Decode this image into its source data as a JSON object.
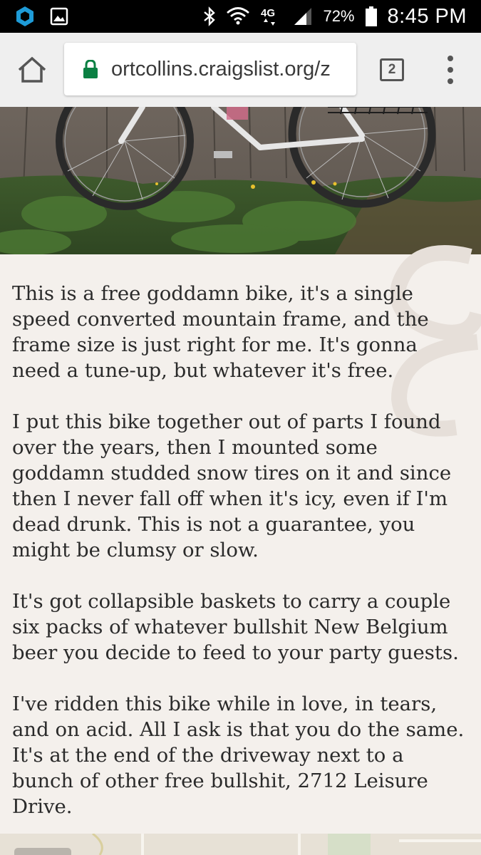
{
  "status_bar": {
    "left_icons": [
      "dex-icon",
      "image-icon"
    ],
    "right_icons": [
      "bluetooth-icon",
      "wifi-icon",
      "lte-icon",
      "signal-icon",
      "battery-icon"
    ],
    "network_label": "4G",
    "battery_percent": "72%",
    "time": "8:45 PM"
  },
  "browser": {
    "url": "ortcollins.craigslist.org/z",
    "tab_count": "2",
    "icons": {
      "home": "home-icon",
      "lock": "lock-icon",
      "menu": "more-vert-icon"
    },
    "colors": {
      "lock": "#0b8043"
    }
  },
  "post": {
    "image": "photo of a white single-speed bike leaning against a wooden fence",
    "paragraphs": [
      "This is a free goddamn bike, it's a single\nspeed converted mountain frame, and the\nframe size is just right for me. It's gonna\nneed a tune-up, but whatever it's free.",
      "I put this bike together out of parts I found\nover the years, then I mounted some\ngoddamn studded snow tires on it and since\nthen I never fall off when it's icy, even if I'm\ndead drunk. This is not a guarantee, you\nmight be clumsy or slow.",
      "It's got collapsible baskets to carry a couple\nsix packs of whatever bullshit New Belgium\nbeer you decide to feed to your party guests.",
      "I've ridden this bike while in love, in tears,\nand on acid. All I ask is that you do the same.\nIt's at the end of the driveway next to a\nbunch of other free bullshit, 2712 Leisure\nDrive."
    ]
  }
}
